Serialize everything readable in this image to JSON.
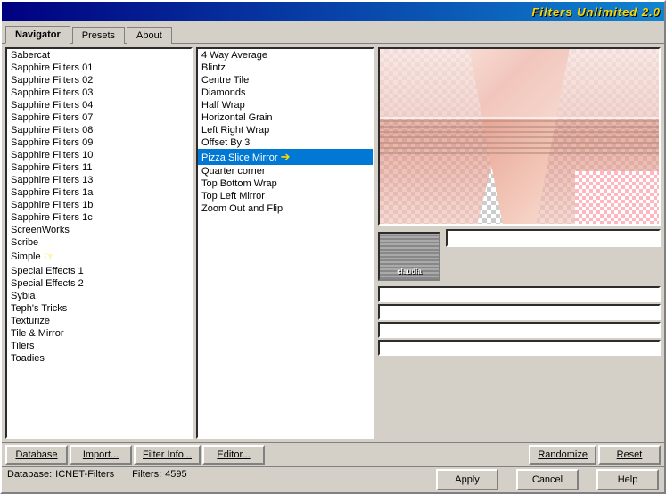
{
  "window": {
    "title": "Filters Unlimited 2.0"
  },
  "tabs": [
    {
      "label": "Navigator",
      "active": true
    },
    {
      "label": "Presets",
      "active": false
    },
    {
      "label": "About",
      "active": false
    }
  ],
  "left_list": {
    "items": [
      "Sabercat",
      "Sapphire Filters 01",
      "Sapphire Filters 02",
      "Sapphire Filters 03",
      "Sapphire Filters 04",
      "Sapphire Filters 07",
      "Sapphire Filters 08",
      "Sapphire Filters 09",
      "Sapphire Filters 10",
      "Sapphire Filters 11",
      "Sapphire Filters 13",
      "Sapphire Filters 1a",
      "Sapphire Filters 1b",
      "Sapphire Filters 1c",
      "ScreenWorks",
      "Scribe",
      "Simple",
      "Special Effects 1",
      "Special Effects 2",
      "Sybia",
      "Teph's Tricks",
      "Texturize",
      "Tile & Mirror",
      "Tilers",
      "Toadies"
    ]
  },
  "right_list": {
    "items": [
      "4 Way Average",
      "Blintz",
      "Centre Tile",
      "Diamonds",
      "Half Wrap",
      "Horizontal Grain",
      "Left Right Wrap",
      "Offset By 3",
      "Pizza Slice Mirror",
      "Quarter corner",
      "Top Bottom Wrap",
      "Top Left Mirror",
      "Zoom Out and Flip"
    ],
    "selected": "Pizza Slice Mirror"
  },
  "filter_name": "Pizza Slice Mirror",
  "bottom_buttons": {
    "database": "Database",
    "import": "Import...",
    "filter_info": "Filter Info...",
    "editor": "Editor...",
    "randomize": "Randomize",
    "reset": "Reset"
  },
  "action_buttons": {
    "apply": "Apply",
    "cancel": "Cancel",
    "help": "Help"
  },
  "status": {
    "database_label": "Database:",
    "database_value": "ICNET-Filters",
    "filters_label": "Filters:",
    "filters_value": "4595"
  },
  "thumb_label": "claudia"
}
